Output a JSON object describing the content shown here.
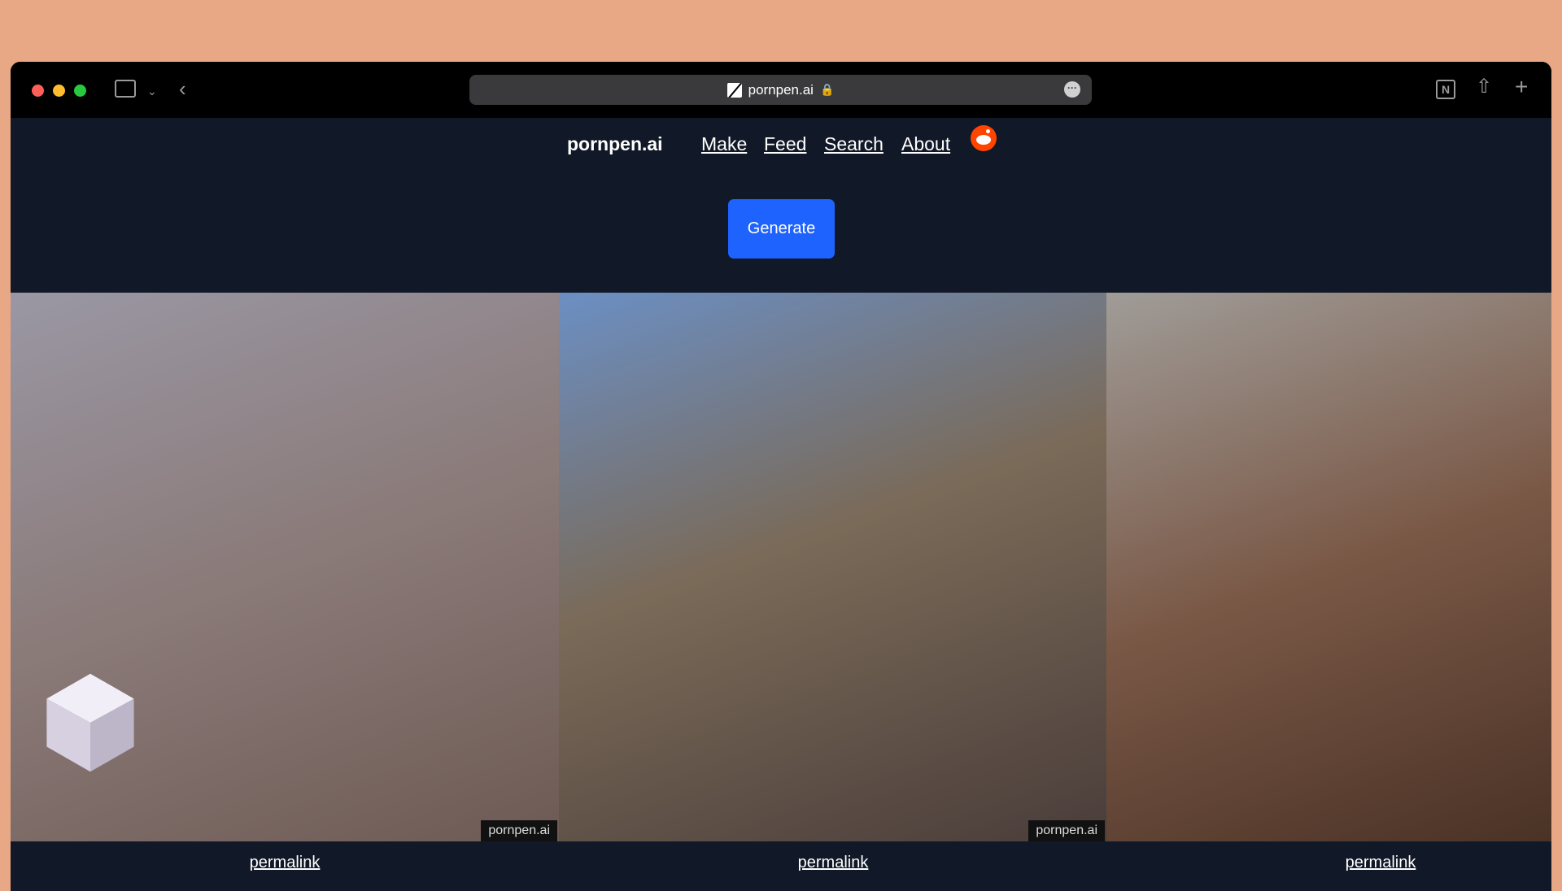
{
  "browser": {
    "url": "pornpen.ai",
    "icons": [
      "sidebar-icon",
      "chevron-down-icon",
      "back-icon",
      "lock-icon",
      "more-icon",
      "notion-icon",
      "share-icon",
      "new-tab-icon"
    ]
  },
  "nav": {
    "brand": "pornpen.ai",
    "links": [
      {
        "label": "Make"
      },
      {
        "label": "Feed"
      },
      {
        "label": "Search"
      },
      {
        "label": "About"
      }
    ],
    "reddit_icon": "reddit-icon"
  },
  "main": {
    "generate_label": "Generate",
    "accent": "#1f63ff",
    "gallery": [
      {
        "watermark": "pornpen.ai",
        "permalink": "permalink"
      },
      {
        "watermark": "pornpen.ai",
        "permalink": "permalink"
      },
      {
        "permalink": "permalink"
      }
    ]
  }
}
